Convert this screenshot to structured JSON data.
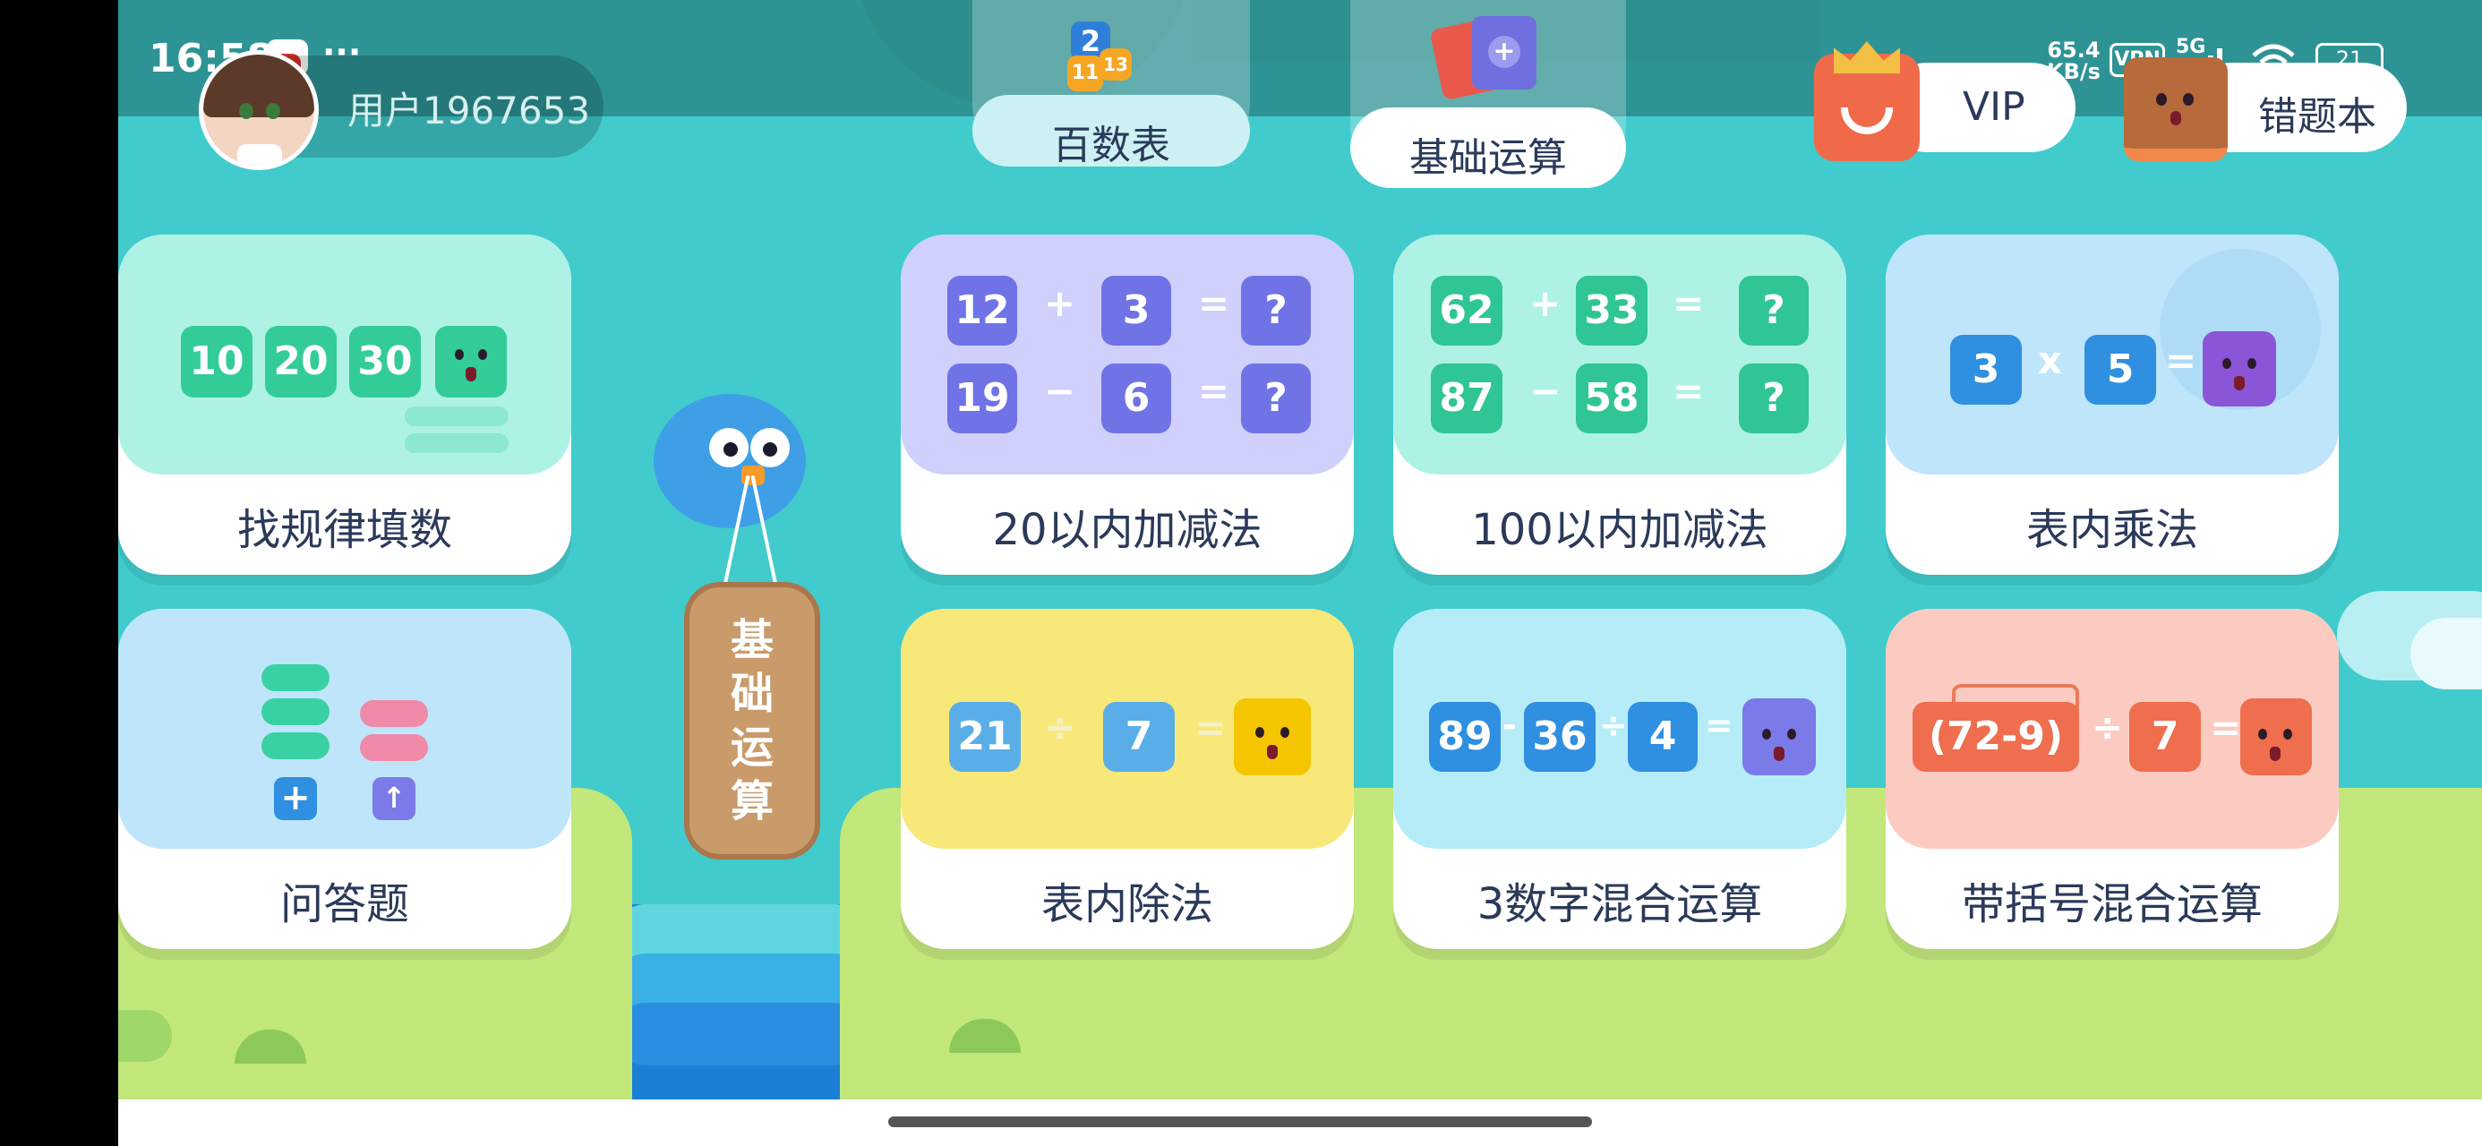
{
  "status_bar": {
    "time": "16:58",
    "dots": "···",
    "net_speed_value": "65.4",
    "net_speed_unit": "KB/s",
    "vpn": "VPN",
    "network": "5G",
    "battery": "21"
  },
  "user": {
    "name": "用户1967653"
  },
  "nav": {
    "tabs": [
      {
        "label": "百数表"
      },
      {
        "label": "基础运算"
      }
    ],
    "vip_label": "VIP",
    "mistakes_label": "错题本",
    "book_icon_numbers": [
      "2",
      "11",
      "13"
    ]
  },
  "sign": {
    "chars": [
      "基",
      "础",
      "运",
      "算"
    ]
  },
  "cards": [
    {
      "label": "找规律填数",
      "color": "#aef2e6",
      "tiles": [
        "10",
        "20",
        "30"
      ]
    },
    {
      "label": "问答题",
      "color": "#bfe5fb"
    },
    {
      "label": "20以内加减法",
      "color": "#cfd0fb",
      "rows": [
        [
          "12",
          "+",
          "3",
          "=",
          "?"
        ],
        [
          "19",
          "−",
          "6",
          "=",
          "?"
        ]
      ]
    },
    {
      "label": "100以内加减法",
      "color": "#aef2e6",
      "rows": [
        [
          "62",
          "+",
          "33",
          "=",
          "?"
        ],
        [
          "87",
          "−",
          "58",
          "=",
          "?"
        ]
      ]
    },
    {
      "label": "表内乘法",
      "color": "#bfe5fb",
      "tiles": [
        "3",
        "x",
        "5",
        "="
      ]
    },
    {
      "label": "表内除法",
      "color": "#f8e87a",
      "tiles": [
        "21",
        "÷",
        "7",
        "="
      ]
    },
    {
      "label": "3数字混合运算",
      "color": "#b6ecf7",
      "tiles": [
        "89",
        "-",
        "36",
        "÷",
        "4",
        "="
      ]
    },
    {
      "label": "带括号混合运算",
      "color": "#fbcbc2",
      "tiles": [
        "(72-9)",
        "÷",
        "7",
        "="
      ]
    }
  ],
  "colors": {
    "sky": "#41cbcc",
    "grass": "#c2e77b",
    "text": "#2b3a5a"
  }
}
